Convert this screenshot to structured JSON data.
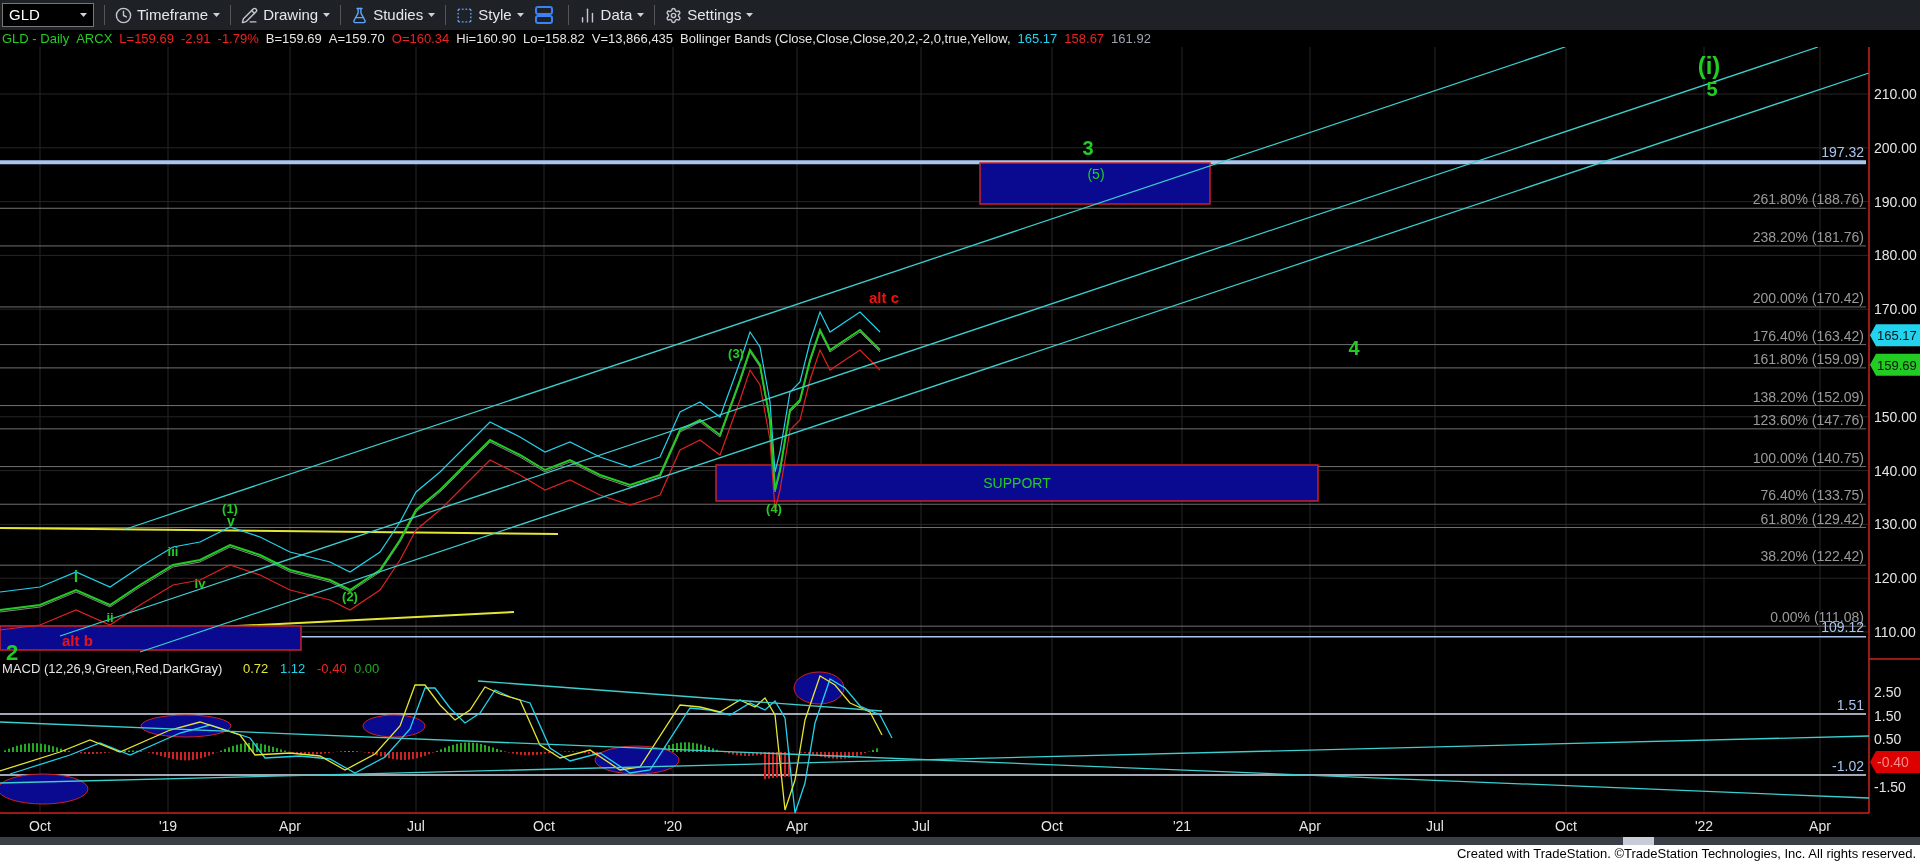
{
  "toolbar": {
    "symbol": "GLD",
    "items": [
      {
        "label": "Timeframe"
      },
      {
        "label": "Drawing"
      },
      {
        "label": "Studies"
      },
      {
        "label": "Style"
      },
      {
        "label": "Data"
      },
      {
        "label": "Settings"
      }
    ]
  },
  "legend": [
    {
      "text": "GLD - Daily",
      "color": "#22cc22"
    },
    {
      "text": "ARCX",
      "color": "#22cc22"
    },
    {
      "text": "L=159.69",
      "color": "#ee2222"
    },
    {
      "text": "-2.91",
      "color": "#ee2222"
    },
    {
      "text": "-1.79%",
      "color": "#ee2222"
    },
    {
      "text": "B=159.69",
      "color": "#e5e5e5"
    },
    {
      "text": "A=159.70",
      "color": "#e5e5e5"
    },
    {
      "text": "O=160.34",
      "color": "#ee2222"
    },
    {
      "text": "Hi=160.90",
      "color": "#e5e5e5"
    },
    {
      "text": "Lo=158.82",
      "color": "#e5e5e5"
    },
    {
      "text": "V=13,866,435",
      "color": "#e5e5e5"
    },
    {
      "text": "Bollinger Bands (Close,Close,Close,20,2,-2,0,true,Yellow,",
      "color": "#e5e5e5"
    },
    {
      "text": "165.17",
      "color": "#22d3ee"
    },
    {
      "text": "158.67",
      "color": "#ee2222"
    },
    {
      "text": "161.92",
      "color": "#9ca3af"
    }
  ],
  "price_axis": [
    "210.00",
    "200.00",
    "190.00",
    "180.00",
    "170.00",
    "150.00",
    "140.00",
    "130.00",
    "120.00",
    "110.00"
  ],
  "fib_levels": [
    "261.80% (188.76)",
    "238.20% (181.76)",
    "200.00% (170.42)",
    "176.40% (163.42)",
    "161.80% (159.09)",
    "138.20% (152.09)",
    "123.60% (147.76)",
    "100.00% (140.75)",
    "76.40% (133.75)",
    "61.80% (129.42)",
    "38.20% (122.42)",
    "0.00% (111.08)"
  ],
  "horizontal_levels": [
    "197.32",
    "109.12"
  ],
  "price_tags": [
    {
      "text": "165.17",
      "color": "#22d3ee"
    },
    {
      "text": "159.69",
      "color": "#22cc22"
    }
  ],
  "wave_labels": [
    {
      "text": "(i)",
      "color": "#22cc22"
    },
    {
      "text": "5",
      "color": "#22cc22"
    },
    {
      "text": "3",
      "color": "#22cc22"
    },
    {
      "text": "alt c",
      "color": "#ee1111"
    },
    {
      "text": "4",
      "color": "#22cc22"
    },
    {
      "text": "(3)",
      "color": "#22cc22"
    },
    {
      "text": "(4)",
      "color": "#22cc22"
    },
    {
      "text": "(1)",
      "color": "#22cc22"
    },
    {
      "text": "v",
      "color": "#22cc22"
    },
    {
      "text": "iii",
      "color": "#22cc22"
    },
    {
      "text": "i",
      "color": "#22cc22"
    },
    {
      "text": "iv",
      "color": "#22cc22"
    },
    {
      "text": "(2)",
      "color": "#22cc22"
    },
    {
      "text": "ii",
      "color": "#22cc22"
    },
    {
      "text": "2",
      "color": "#22cc22"
    }
  ],
  "zones": [
    {
      "label": "(5)",
      "color": "#22cc22"
    },
    {
      "label": "SUPPORT",
      "color": "#22cc22"
    },
    {
      "label": "alt b",
      "color": "#ee1111"
    }
  ],
  "macd": {
    "title": "MACD (12,26,9,Green,Red,DarkGray)",
    "values": [
      {
        "text": "0.72",
        "color": "#e5e533"
      },
      {
        "text": "1.12",
        "color": "#22d3ee"
      },
      {
        "text": "-0.40",
        "color": "#ee2222"
      },
      {
        "text": "0.00",
        "color": "#22aa22"
      }
    ],
    "axis": [
      "2.50",
      "1.50",
      "0.50",
      "-1.50"
    ],
    "levels": [
      "1.51",
      "-1.02"
    ],
    "tag": {
      "text": "-0.40",
      "color": "#dd0000"
    }
  },
  "time_axis": [
    "Oct",
    "'19",
    "Apr",
    "Jul",
    "Oct",
    "'20",
    "Apr",
    "Jul",
    "Oct",
    "'21",
    "Apr",
    "Jul",
    "Oct",
    "'22",
    "Apr"
  ],
  "footer": "Created with TradeStation. ©TradeStation Technologies, Inc. All rights reserved."
}
